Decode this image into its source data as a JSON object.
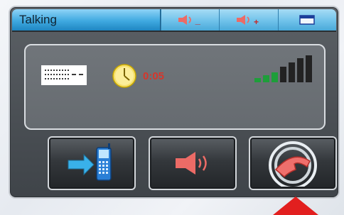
{
  "window": {
    "title": "Talking"
  },
  "toolbar": {
    "volume_down_label": "_",
    "volume_up_label": "+"
  },
  "call": {
    "timer": "0:05",
    "signal_bars_active": 3,
    "signal_bars_total": 6
  },
  "colors": {
    "accent_blue": "#3fa9e0",
    "alert_red": "#d6362b",
    "signal_green": "#1e9e3a",
    "panel_dark": "#4b5055"
  },
  "icons": {
    "volume_down": "speaker-minus-icon",
    "volume_up": "speaker-plus-icon",
    "minimize": "window-bar-icon",
    "caller_id": "caller-id-icon",
    "clock": "clock-icon",
    "signal": "signal-strength-icon",
    "transfer": "transfer-to-phone-icon",
    "speaker": "speaker-icon",
    "hangup": "hang-up-icon",
    "pointer": "arrow-up-pointer"
  }
}
